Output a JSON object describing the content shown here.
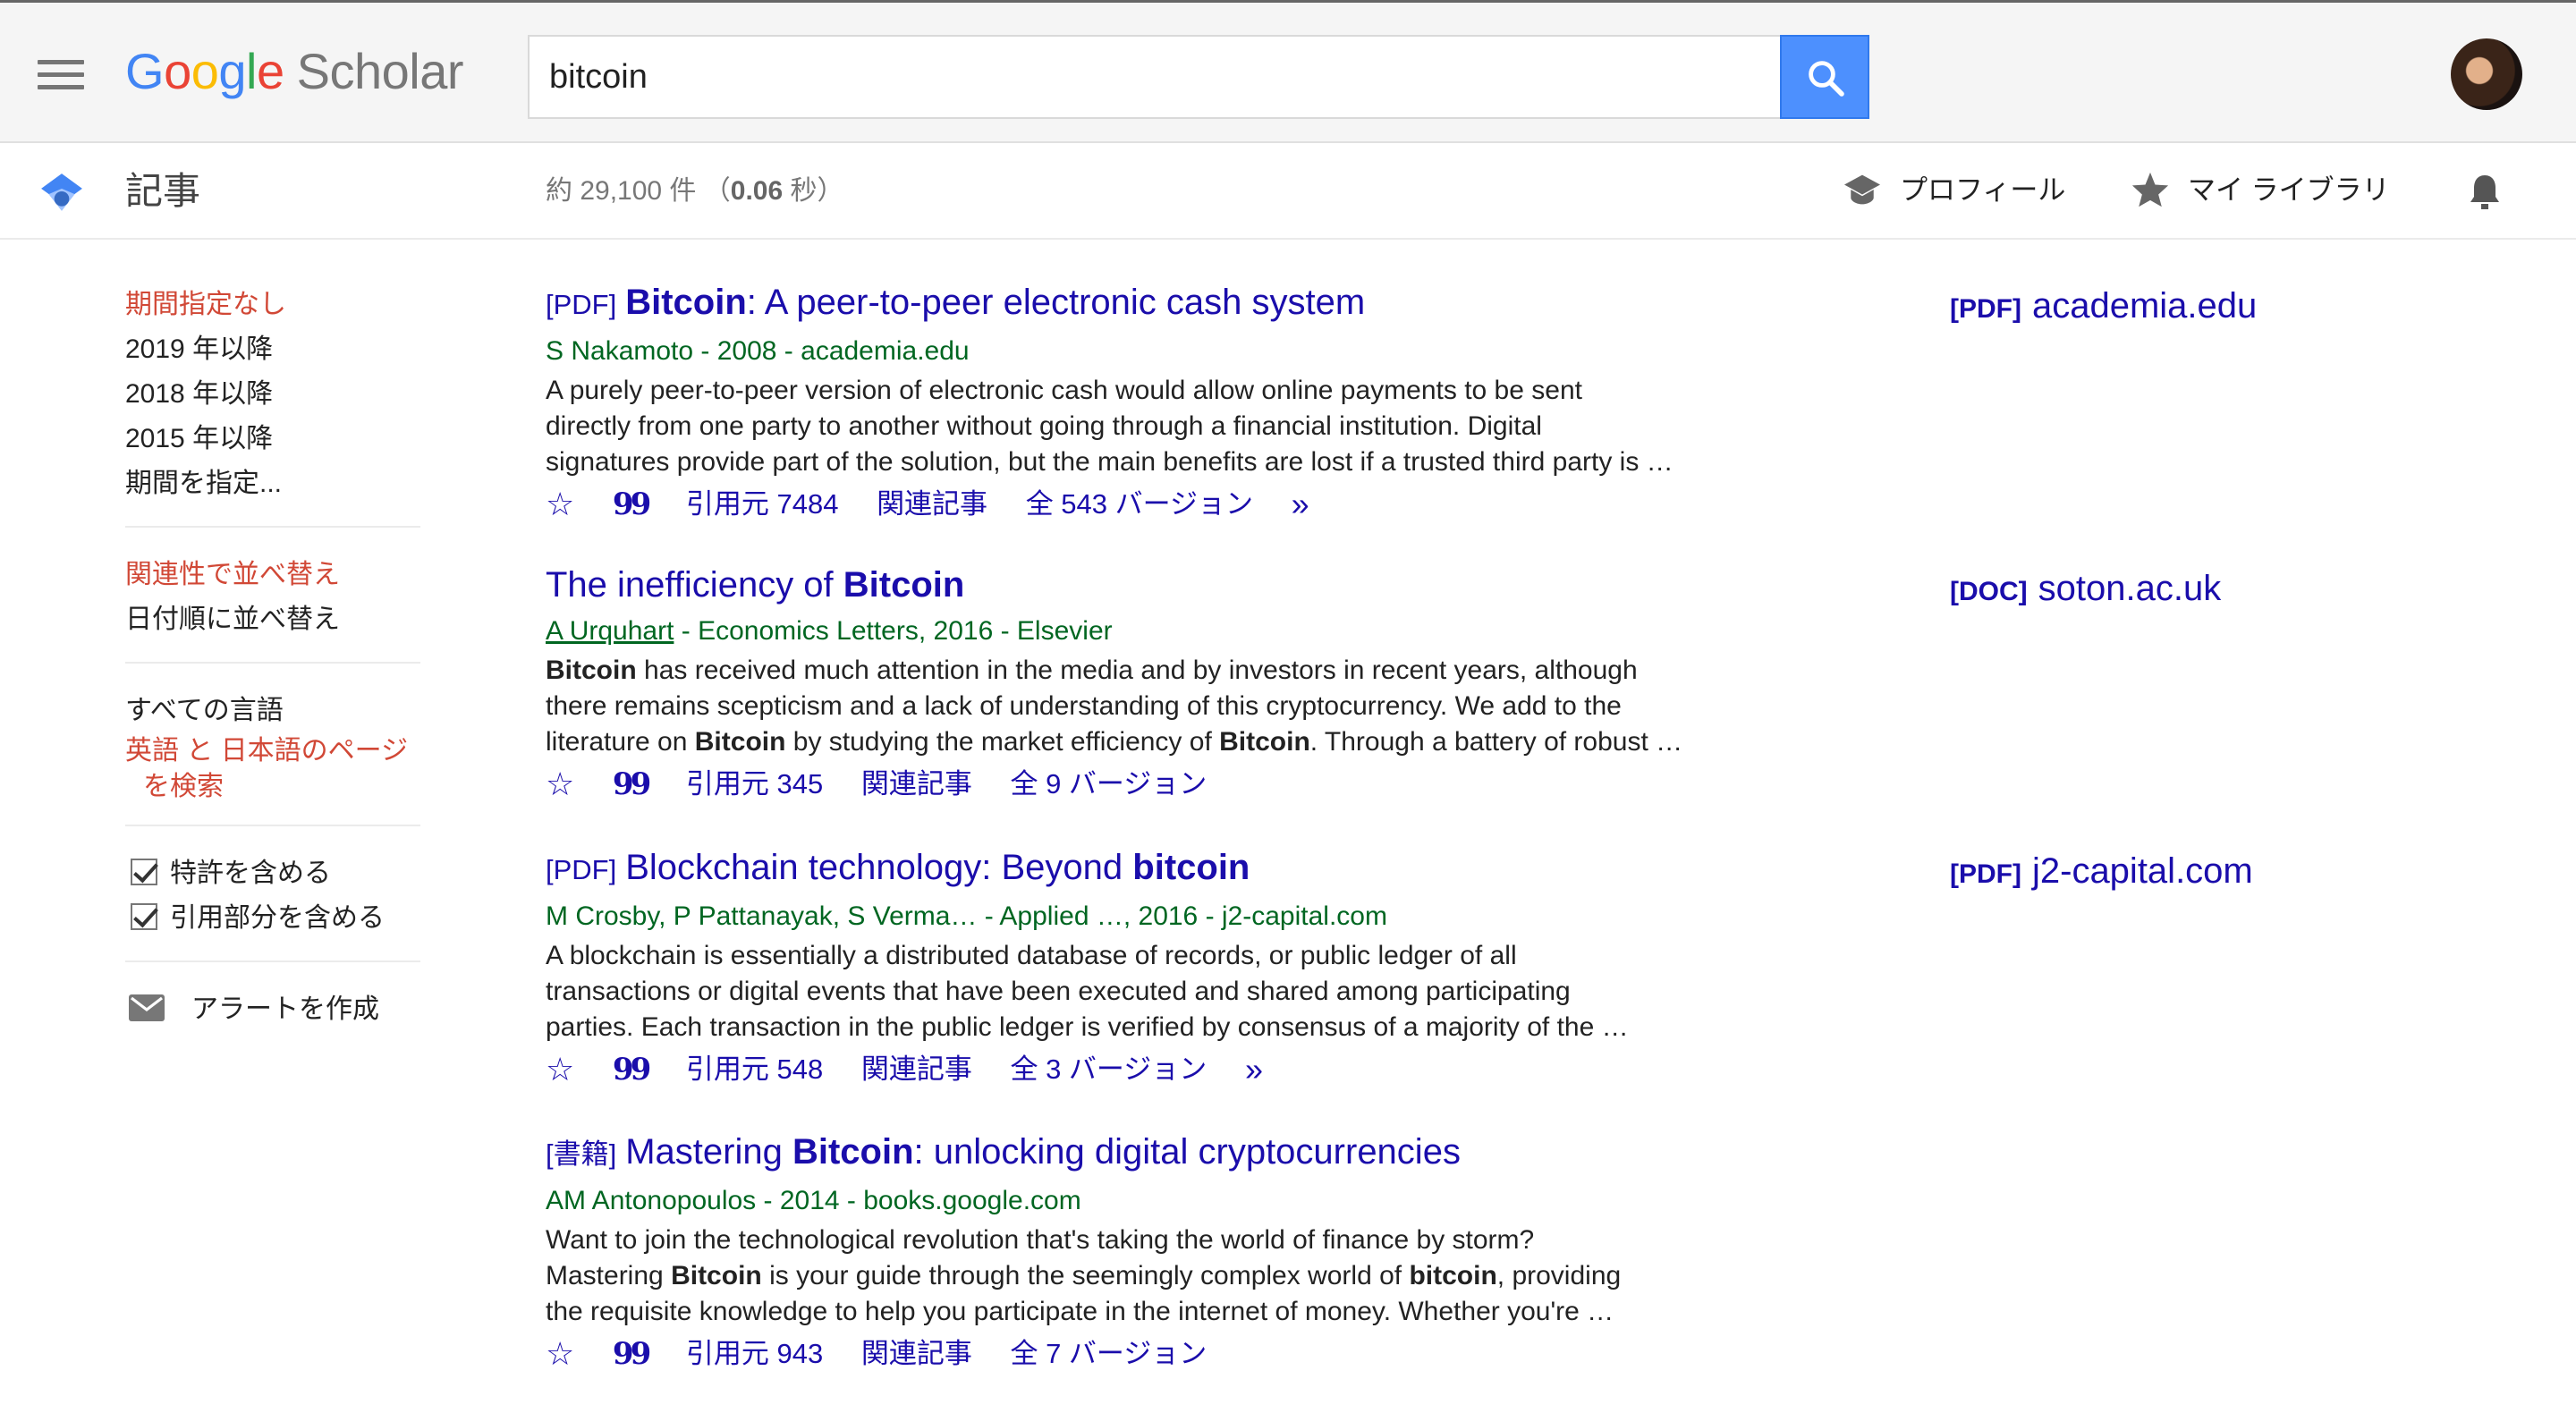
{
  "header": {
    "logo_google": [
      "G",
      "o",
      "o",
      "g",
      "l",
      "e"
    ],
    "logo_scholar": "Scholar",
    "search_value": "bitcoin"
  },
  "subheader": {
    "articles": "記事",
    "stats_prefix": "約 29,100 件 （",
    "stats_time": "0.06",
    "stats_suffix": " 秒）",
    "profile": "プロフィール",
    "library": "マイ ライブラリ"
  },
  "sidebar": {
    "time": [
      "期間指定なし",
      "2019 年以降",
      "2018 年以降",
      "2015 年以降",
      "期間を指定..."
    ],
    "sort": [
      "関連性で並べ替え",
      "日付順に並べ替え"
    ],
    "lang": [
      "すべての言語",
      "英語 と 日本語のページを検索"
    ],
    "checks": [
      "特許を含める",
      "引用部分を含める"
    ],
    "alert": "アラートを作成"
  },
  "results": [
    {
      "tag": "[PDF]",
      "title_bold": "Bitcoin",
      "title_rest": ": A peer-to-peer electronic cash system",
      "meta": "S Nakamoto - 2008 - academia.edu",
      "snippet": [
        "A purely peer-to-peer version of electronic cash would allow online payments to be sent",
        "directly from one party to another without going through a financial institution. Digital",
        "signatures provide part of the solution, but the main benefits are lost if a trusted third party is …"
      ],
      "cited": "引用元 7484",
      "related": "関連記事",
      "versions": "全 543 バージョン",
      "side_tag": "[PDF]",
      "side_domain": "academia.edu"
    },
    {
      "title_pre": "The inefficiency of ",
      "title_bold": "Bitcoin",
      "meta_author": "A Urquhart",
      "meta_rest": " - Economics Letters, 2016 - Elsevier",
      "snippet_l1_bold": "Bitcoin",
      "snippet_l1_rest": " has received much attention in the media and by investors in recent years, although",
      "snippet_l2": "there remains scepticism and a lack of understanding of this cryptocurrency. We add to the",
      "snippet_l3_a": "literature on ",
      "snippet_l3_b1": "Bitcoin",
      "snippet_l3_c": " by studying the market efficiency of ",
      "snippet_l3_b2": "Bitcoin",
      "snippet_l3_d": ". Through a battery of robust …",
      "cited": "引用元 345",
      "related": "関連記事",
      "versions": "全 9 バージョン",
      "side_tag": "[DOC]",
      "side_domain": "soton.ac.uk"
    },
    {
      "tag": "[PDF]",
      "title_rest": "Blockchain technology: Beyond ",
      "title_bold": "bitcoin",
      "meta": "M Crosby, P Pattanayak, S Verma… - Applied …, 2016 - j2-capital.com",
      "snippet": [
        "A blockchain is essentially a distributed database of records, or public ledger of all",
        "transactions or digital events that have been executed and shared among participating",
        "parties. Each transaction in the public ledger is verified by consensus of a majority of the …"
      ],
      "cited": "引用元 548",
      "related": "関連記事",
      "versions": "全 3 バージョン",
      "side_tag": "[PDF]",
      "side_domain": "j2-capital.com"
    },
    {
      "tag": "[書籍]",
      "title_pre": "Mastering ",
      "title_bold": "Bitcoin",
      "title_rest": ": unlocking digital cryptocurrencies",
      "meta": "AM Antonopoulos - 2014 - books.google.com",
      "snippet_l1": "Want to join the technological revolution that's taking the world of finance by storm?",
      "snippet_l2_a": "Mastering ",
      "snippet_l2_b": "Bitcoin",
      "snippet_l2_c": " is your guide through the seemingly complex world of ",
      "snippet_l2_d": "bitcoin",
      "snippet_l2_e": ", providing",
      "snippet_l3": "the requisite knowledge to help you participate in the internet of money. Whether you're …",
      "cited": "引用元 943",
      "related": "関連記事",
      "versions": "全 7 バージョン"
    }
  ],
  "colors": {
    "link": "#1a0dab",
    "meta": "#006621",
    "selected": "#d14836",
    "search_btn": "#4d90fe"
  },
  "icons": [
    "menu-icon",
    "search-icon",
    "scholar-cap-icon",
    "graduation-cap-icon",
    "star-icon",
    "bell-icon",
    "envelope-icon",
    "quote-icon",
    "double-chevron-icon"
  ]
}
